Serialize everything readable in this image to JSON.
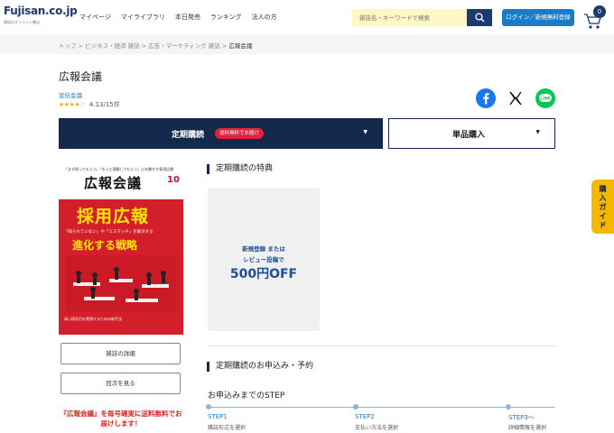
{
  "header": {
    "logo": "Fujisan.co.jp",
    "logo_sub": "雑誌のオンライン書店",
    "nav": [
      "マイページ",
      "マイライブラリ",
      "本日発売",
      "ランキング",
      "法人の方"
    ],
    "search_placeholder": "雑誌名・キーワードで検索",
    "login_label": "ログイン／新規無料登録",
    "cart_count": "0"
  },
  "breadcrumb": {
    "items": [
      "トップ",
      "ビジネス・経済 雑誌",
      "広告・マーケティング 雑誌"
    ],
    "current": "広報会議"
  },
  "product": {
    "title": "広報会議",
    "publisher": "宣伝会議",
    "stars": "★★★★☆",
    "rating_text": "4.13/15件"
  },
  "purchase": {
    "subscription_label": "定期購読",
    "subscription_badge": "送料無料でお届け",
    "single_label": "単品購入"
  },
  "cover": {
    "tagline": "「まず知ってもらう」「もっと理解してもらう」心を動かす採用広報",
    "magazine": "広報会議",
    "issue": "10",
    "headline": "採用広報",
    "subhead": "「知られていない」や「ミスマッチ」を解決する",
    "headline2": "進化する戦略",
    "footer": "高い採用力を実現するための新手法"
  },
  "side": {
    "details_button": "雑誌の詳細",
    "toc_button": "目次を見る",
    "free_note": "『広報会議』を毎号確実に送料無料でお届けします！"
  },
  "benefits": {
    "heading": "定期購読の特典",
    "line1": "新規登録 または",
    "line2": "レビュー投稿で",
    "amount": "500円OFF"
  },
  "apply": {
    "heading": "定期購読のお申込み・予約",
    "step_title": "お申込みまでのSTEP",
    "steps": [
      {
        "label": "STEP1",
        "desc": "雑誌形式を選択"
      },
      {
        "label": "STEP2",
        "desc": "支払い方法を選択"
      },
      {
        "label": "STEP3〜",
        "desc": "詳細情報を選択"
      }
    ]
  },
  "guide_tab": "購入ガイド",
  "colors": {
    "navy": "#132a4d",
    "accent_red": "#e0223f",
    "link_blue": "#1a7cc6",
    "guide_yellow": "#f5b800"
  }
}
